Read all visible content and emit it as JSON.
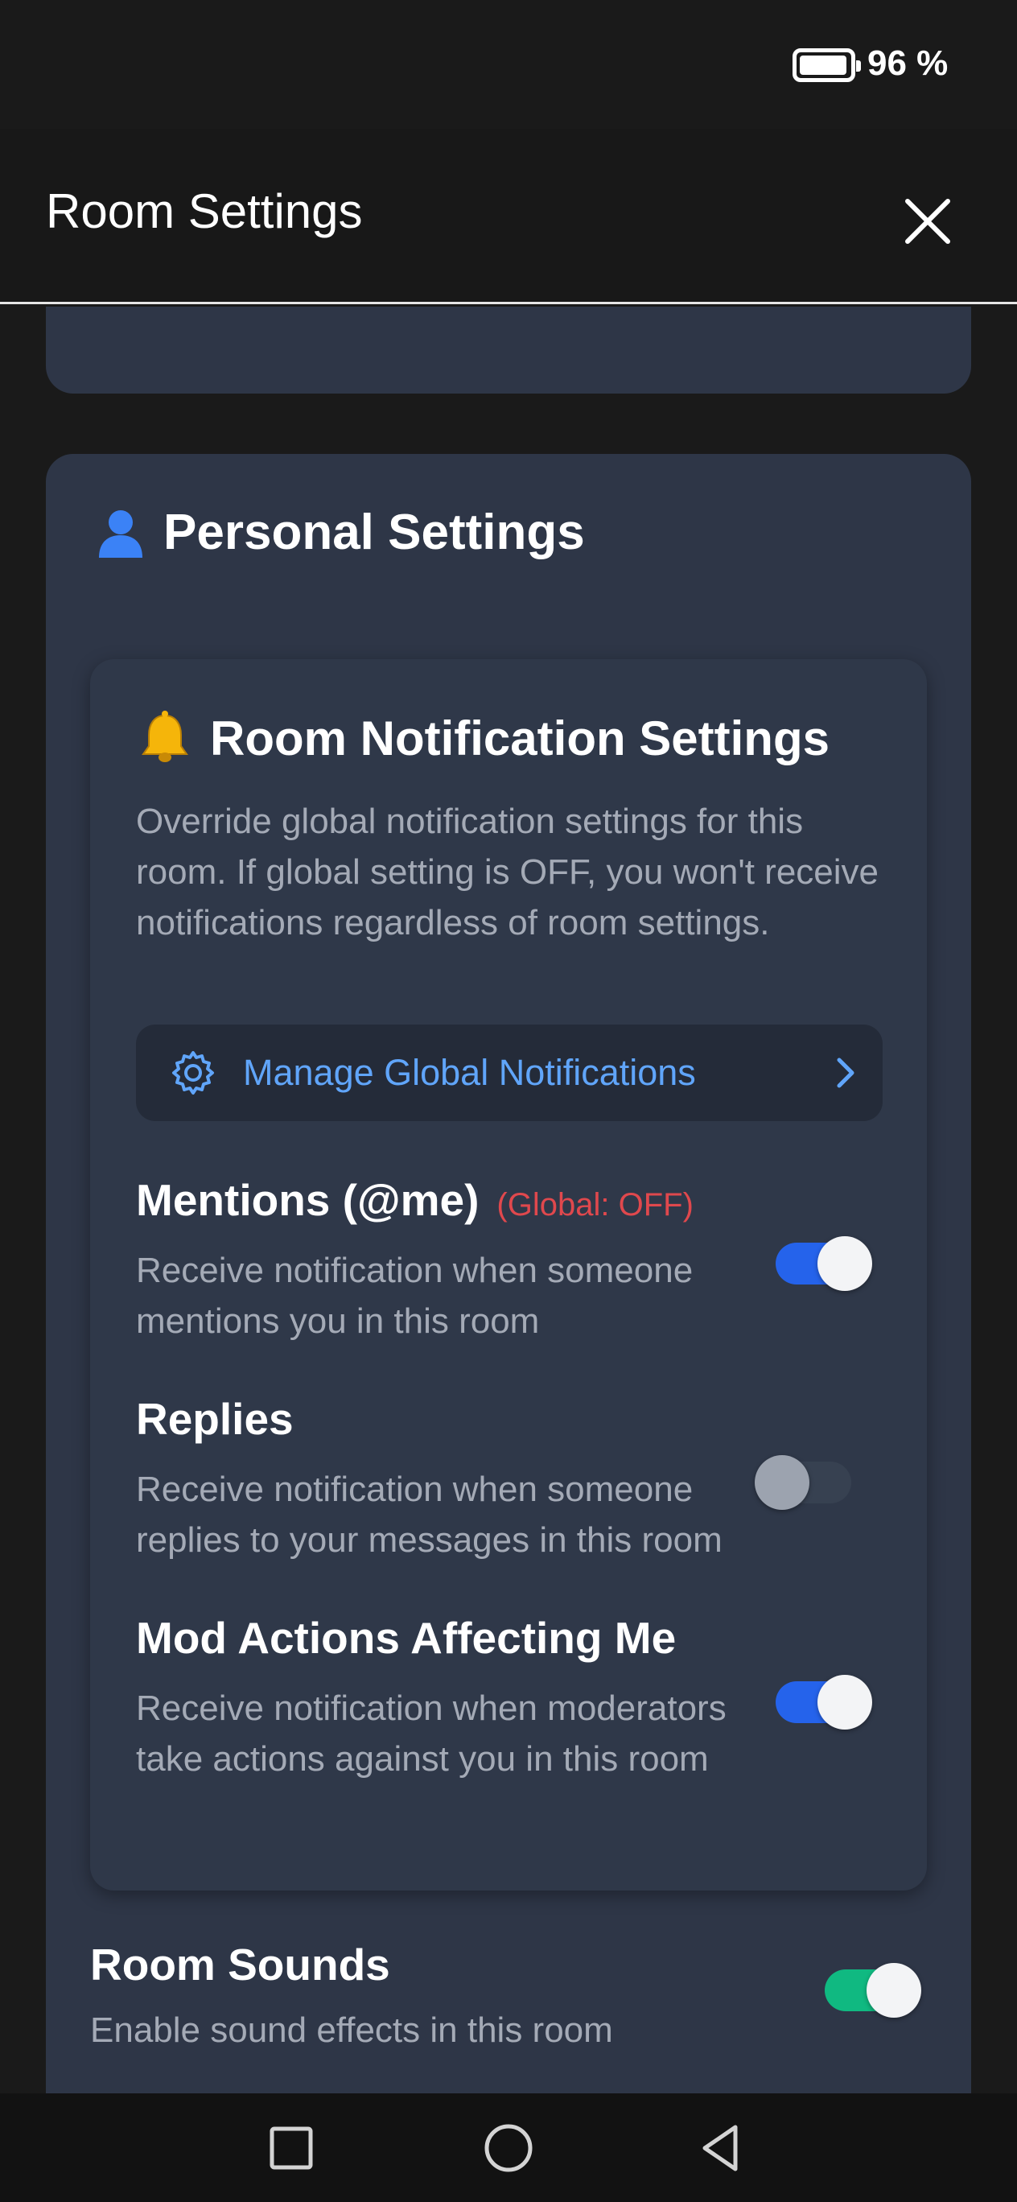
{
  "status_bar": {
    "battery_text": "96 %",
    "battery_level_percent": 96
  },
  "header": {
    "title": "Room Settings",
    "close_icon": "close-icon"
  },
  "personal": {
    "title": "Personal Settings",
    "icon": "person-icon",
    "notifications": {
      "title": "Room Notification Settings",
      "icon": "bell-icon",
      "description": "Override global notification settings for this room. If global setting is OFF, you won't receive notifications regardless of room settings.",
      "manage_button": {
        "label": "Manage Global Notifications",
        "icon": "gear-icon",
        "chevron": "chevron-right-icon"
      },
      "settings": [
        {
          "title": "Mentions (@me)",
          "global_note": "(Global: OFF)",
          "description": "Receive notification when someone mentions you in this room",
          "enabled": true
        },
        {
          "title": "Replies",
          "description": "Receive notification when someone replies to your messages in this room",
          "enabled": false
        },
        {
          "title": "Mod Actions Affecting Me",
          "description": "Receive notification when moderators take actions against you in this room",
          "enabled": true
        }
      ]
    },
    "room_sounds": {
      "title": "Room Sounds",
      "description": "Enable sound effects in this room",
      "enabled": true
    }
  },
  "nav_bar": {
    "items": [
      "recents-square-icon",
      "home-circle-icon",
      "back-triangle-icon"
    ]
  },
  "colors": {
    "accent_blue": "#2563eb",
    "accent_green": "#10b981",
    "link_blue": "#60a5fa",
    "warning_red": "#e0484d",
    "card_bg": "#2e3647"
  }
}
